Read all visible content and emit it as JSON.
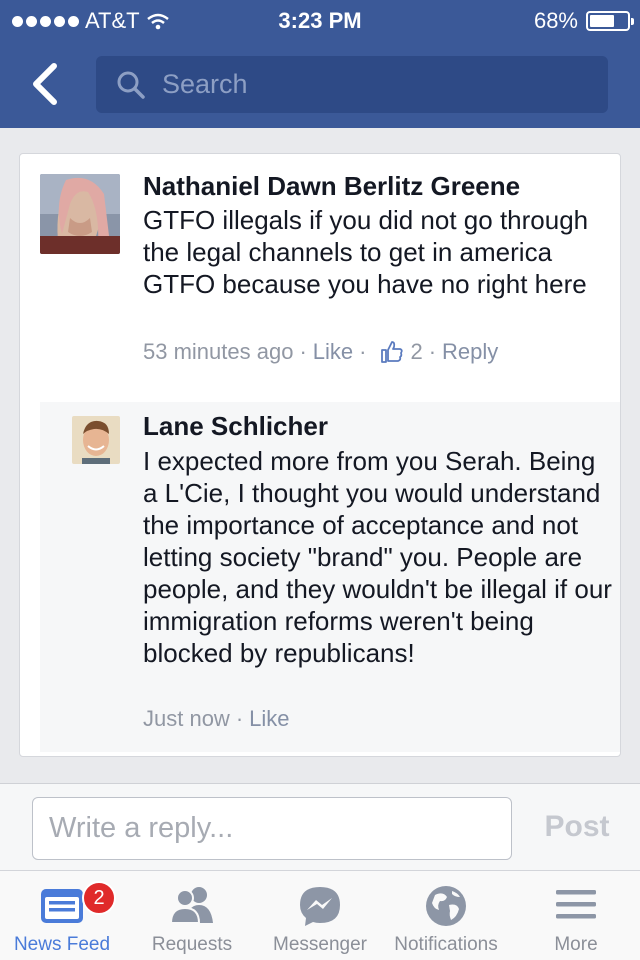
{
  "status_bar": {
    "carrier": "AT&T",
    "time": "3:23 PM",
    "battery": "68%",
    "battery_level": 0.68
  },
  "header": {
    "search_placeholder": "Search"
  },
  "comments": [
    {
      "author": "Nathaniel Dawn Berlitz Greene",
      "text": "GTFO illegals if you did not go through the legal channels to get in america GTFO because you have no right here",
      "time": "53 minutes ago",
      "like_label": "Like",
      "like_count": "2",
      "reply_label": "Reply"
    },
    {
      "author": "Lane Schlicher",
      "text": "I expected more from you Serah. Being a L'Cie, I thought you would understand the importance of acceptance and not letting society \"brand\" you. People are people, and they wouldn't be illegal if our immigration reforms weren't being blocked by republicans!",
      "time": "Just now",
      "like_label": "Like"
    }
  ],
  "composer": {
    "placeholder": "Write a reply...",
    "post_label": "Post"
  },
  "tabbar": {
    "items": [
      {
        "label": "News Feed",
        "badge": "2",
        "icon": "news-feed-icon"
      },
      {
        "label": "Requests",
        "icon": "friend-requests-icon"
      },
      {
        "label": "Messenger",
        "icon": "messenger-icon"
      },
      {
        "label": "Notifications",
        "icon": "globe-icon"
      },
      {
        "label": "More",
        "icon": "hamburger-menu-icon"
      }
    ]
  },
  "colors": {
    "brand": "#3b5998",
    "active_tab": "#4a7bd9",
    "badge": "#e02a2a"
  }
}
